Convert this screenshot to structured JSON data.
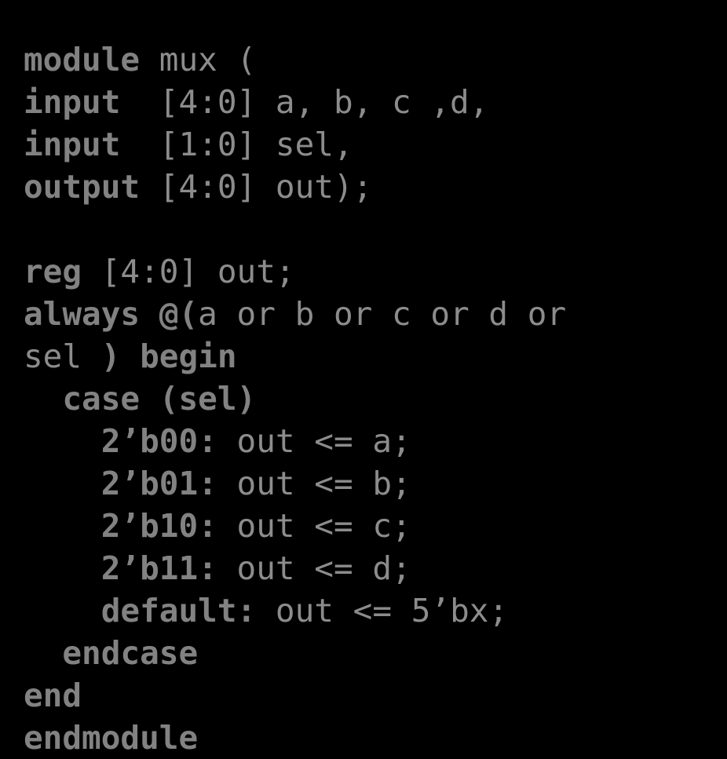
{
  "slide": {
    "background_color": "#000000",
    "keyword_color": "#828282",
    "text_color": "#8c8c8c",
    "language": "verilog",
    "title": "mux"
  },
  "code": {
    "lines": [
      {
        "index": 0,
        "indent": "",
        "tokens": [
          {
            "t": "module",
            "bold": true
          },
          {
            "t": " mux (",
            "bold": false
          }
        ],
        "text": "module mux ("
      },
      {
        "index": 1,
        "indent": "",
        "tokens": [
          {
            "t": "input",
            "bold": true
          },
          {
            "t": "  [4:0] a, b, c ,d,",
            "bold": false
          }
        ],
        "text": "input  [4:0] a, b, c ,d,"
      },
      {
        "index": 2,
        "indent": "",
        "tokens": [
          {
            "t": "input",
            "bold": true
          },
          {
            "t": "  [1:0] sel,",
            "bold": false
          }
        ],
        "text": "input  [1:0] sel,"
      },
      {
        "index": 3,
        "indent": "",
        "tokens": [
          {
            "t": "output",
            "bold": true
          },
          {
            "t": " [4:0] out);",
            "bold": false
          }
        ],
        "text": "output [4:0] out);"
      },
      {
        "index": 4,
        "indent": "",
        "tokens": [],
        "text": ""
      },
      {
        "index": 5,
        "indent": "",
        "tokens": [
          {
            "t": "reg",
            "bold": true
          },
          {
            "t": " [4:0] out;",
            "bold": false
          }
        ],
        "text": "reg [4:0] out;"
      },
      {
        "index": 6,
        "indent": "",
        "tokens": [
          {
            "t": "always",
            "bold": true
          },
          {
            "t": " ",
            "bold": false
          },
          {
            "t": "@(",
            "bold": true
          },
          {
            "t": "a or b or c or d or",
            "bold": false
          }
        ],
        "text": "always @(a or b or c or d or"
      },
      {
        "index": 7,
        "indent": "",
        "tokens": [
          {
            "t": "sel ",
            "bold": false
          },
          {
            "t": ") begin",
            "bold": true
          }
        ],
        "text": "sel ) begin"
      },
      {
        "index": 8,
        "indent": "  ",
        "tokens": [
          {
            "t": "  ",
            "bold": false
          },
          {
            "t": "case (sel)",
            "bold": true
          }
        ],
        "text": "  case (sel)"
      },
      {
        "index": 9,
        "indent": "    ",
        "tokens": [
          {
            "t": "    ",
            "bold": false
          },
          {
            "t": "2’b00:",
            "bold": true
          },
          {
            "t": " out <= a;",
            "bold": false
          }
        ],
        "text": "    2’b00: out <= a;"
      },
      {
        "index": 10,
        "indent": "    ",
        "tokens": [
          {
            "t": "    ",
            "bold": false
          },
          {
            "t": "2’b01:",
            "bold": true
          },
          {
            "t": " out <= b;",
            "bold": false
          }
        ],
        "text": "    2’b01: out <= b;"
      },
      {
        "index": 11,
        "indent": "    ",
        "tokens": [
          {
            "t": "    ",
            "bold": false
          },
          {
            "t": "2’b10:",
            "bold": true
          },
          {
            "t": " out <= c;",
            "bold": false
          }
        ],
        "text": "    2’b10: out <= c;"
      },
      {
        "index": 12,
        "indent": "    ",
        "tokens": [
          {
            "t": "    ",
            "bold": false
          },
          {
            "t": "2’b11:",
            "bold": true
          },
          {
            "t": " out <= d;",
            "bold": false
          }
        ],
        "text": "    2’b11: out <= d;"
      },
      {
        "index": 13,
        "indent": "    ",
        "tokens": [
          {
            "t": "    ",
            "bold": false
          },
          {
            "t": "default:",
            "bold": true
          },
          {
            "t": " out <= 5’bx;",
            "bold": false
          }
        ],
        "text": "    default: out <= 5’bx;"
      },
      {
        "index": 14,
        "indent": "  ",
        "tokens": [
          {
            "t": "  ",
            "bold": false
          },
          {
            "t": "endcase",
            "bold": true
          }
        ],
        "text": "  endcase"
      },
      {
        "index": 15,
        "indent": "",
        "tokens": [
          {
            "t": "end",
            "bold": true
          }
        ],
        "text": "end"
      },
      {
        "index": 16,
        "indent": "",
        "tokens": [
          {
            "t": "endmodule",
            "bold": true
          }
        ],
        "text": "endmodule"
      }
    ]
  }
}
